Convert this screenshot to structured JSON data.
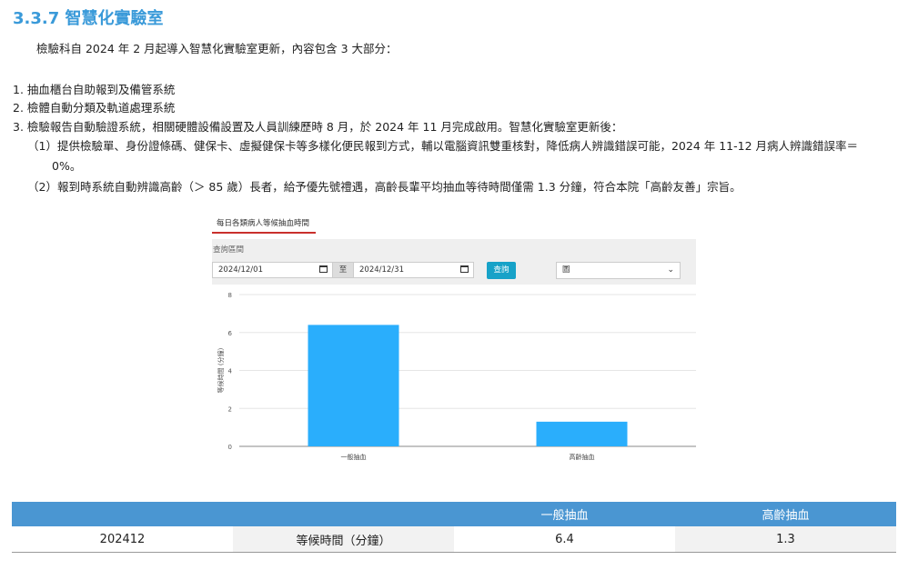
{
  "doc": {
    "heading": "3.3.7 智慧化實驗室",
    "intro": "檢驗科自 2024 年 2 月起導入智慧化實驗室更新，內容包含 3 大部分：",
    "items": [
      "1.  抽血櫃台自助報到及備管系統",
      "2.  檢體自動分類及軌道處理系統",
      "3.  檢驗報告自動驗證系統，相關硬體設備設置及人員訓練歷時 8 月，於 2024 年 11 月完成啟用。智慧化實驗室更新後："
    ],
    "subitems": [
      "（1）提供檢驗單、身份證條碼、健保卡、虛擬健保卡等多樣化便民報到方式，輔以電腦資訊雙重核對，降低病人辨識錯誤可能，2024 年 11-12 月病人辨識錯誤率＝",
      "0%。",
      "（2）報到時系統自動辨識高齡（＞ 85 歲）長者，給予優先號禮遇，高齡長輩平均抽血等待時間僅需 1.3 分鐘，符合本院「高齡友善」宗旨。"
    ]
  },
  "widget": {
    "tab": "每日各類病人等候抽血時間",
    "query_label": "查詢區間",
    "start_date": "2024/12/01",
    "to_label": "至",
    "end_date": "2024/12/31",
    "query_button": "查詢",
    "select_value": "圖"
  },
  "chart_data": {
    "type": "bar",
    "categories": [
      "一般抽血",
      "高齡抽血"
    ],
    "values": [
      6.4,
      1.3
    ],
    "ylabel": "等候時間 (分鐘)",
    "ylim": [
      0,
      8
    ],
    "yticks": [
      0,
      2,
      4,
      6,
      8
    ],
    "grid": true,
    "color": "#2aaefc"
  },
  "table": {
    "headers": [
      "",
      "",
      "一般抽血",
      "高齡抽血"
    ],
    "rows": [
      [
        "202412",
        "等候時間（分鐘）",
        "6.4",
        "1.3"
      ]
    ]
  }
}
